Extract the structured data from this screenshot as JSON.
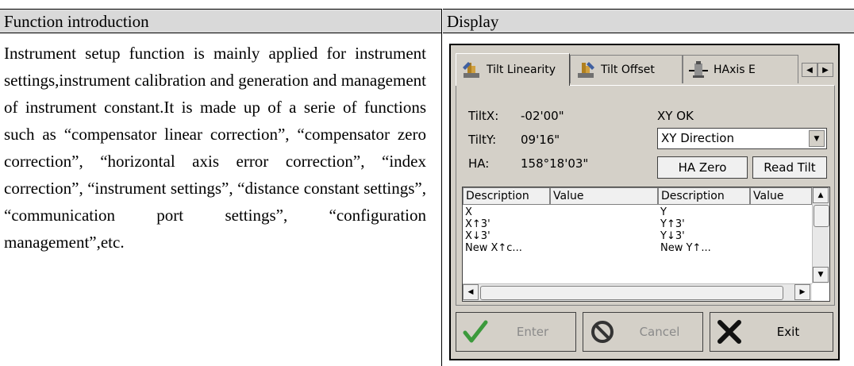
{
  "header": {
    "left": "Function introduction",
    "right": "Display"
  },
  "intro": {
    "text": "Instrument setup function is mainly applied for instrument settings,instrument calibration and generation and management of instrument constant.It is made up of a serie of functions such as “compensator linear correction”, “compensator zero correction”, “horizontal axis error correction”, “index correction”, “instrument settings”, “distance constant settings”, “communication port settings”, “configuration management”,etc."
  },
  "device": {
    "tabs": [
      {
        "label": "Tilt Linearity",
        "icon": "tilt-linearity-icon",
        "active": true
      },
      {
        "label": "Tilt Offset",
        "icon": "tilt-offset-icon",
        "active": false
      },
      {
        "label": "HAxis E",
        "icon": "haxis-icon",
        "active": false
      }
    ],
    "readouts": {
      "tiltx_label": "TiltX:",
      "tiltx_value": "-02'00\"",
      "tilty_label": "TiltY:",
      "tilty_value": "09'16\"",
      "ha_label": "HA:",
      "ha_value": "158°18'03\"",
      "status": "XY OK"
    },
    "direction_select": {
      "value": "XY Direction"
    },
    "buttons": {
      "ha_zero": "HA Zero",
      "read_tilt": "Read Tilt"
    },
    "table": {
      "columns": [
        "Description",
        "Value",
        "Description",
        "Value"
      ],
      "left_rows": [
        "X",
        "X↑3'",
        "X↓3'",
        "New X↑c..."
      ],
      "right_rows": [
        "Y",
        "Y↑3'",
        "Y↓3'",
        "New Y↑..."
      ]
    },
    "actions": {
      "enter": "Enter",
      "cancel": "Cancel",
      "exit": "Exit"
    }
  },
  "colors": {
    "header_bg": "#d9d9d9",
    "device_bg": "#d4d0c8",
    "disabled_text": "#8a8a8a"
  }
}
